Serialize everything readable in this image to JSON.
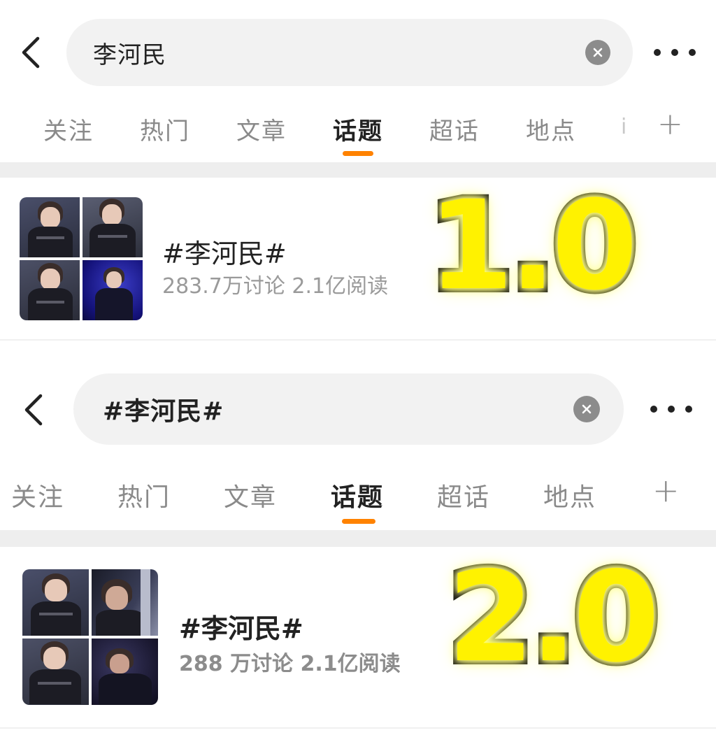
{
  "panels": [
    {
      "search": {
        "query": "李河民"
      },
      "tabs": [
        {
          "label": "关注"
        },
        {
          "label": "热门"
        },
        {
          "label": "文章"
        },
        {
          "label": "话题",
          "active": true
        },
        {
          "label": "超话"
        },
        {
          "label": "地点"
        }
      ],
      "tab_more_symbol": "+",
      "topic": {
        "title": "#李河民#",
        "stats": "283.7万讨论 2.1亿阅读"
      },
      "version_label": "1.0"
    },
    {
      "search": {
        "query": "#李河民#"
      },
      "tabs": [
        {
          "label": "关注"
        },
        {
          "label": "热门"
        },
        {
          "label": "文章"
        },
        {
          "label": "话题",
          "active": true
        },
        {
          "label": "超话"
        },
        {
          "label": "地点"
        }
      ],
      "tab_more_symbol": "+",
      "topic": {
        "title": "#李河民#",
        "stats": "288 万讨论 2.1亿阅读"
      },
      "version_label": "2.0"
    }
  ],
  "colors": {
    "accent_underline": "#ff8200",
    "search_bg": "#f2f2f2",
    "version_fill": "#fff200",
    "version_stroke": "#111111"
  },
  "icons": {
    "back": "chevron-left-icon",
    "clear": "clear-circle-icon",
    "more": "more-dots-icon",
    "add_tab": "plus-icon"
  }
}
